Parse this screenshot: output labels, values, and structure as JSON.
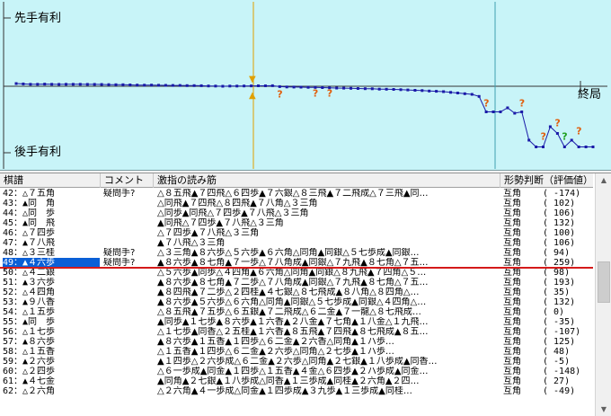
{
  "graph": {
    "sente_label": "先手有利",
    "gote_label": "後手有利",
    "end_label": "終局",
    "cursor_marker_top": "▼",
    "cursor_marker_bottom": "▲",
    "question_mark": "?",
    "colors": {
      "background": "#c8f4f8",
      "line": "#1a1aa8",
      "cursor": "#e0a000",
      "bad_move": "#e06010",
      "good_move": "#20a020"
    },
    "eval_series": [
      40,
      35,
      30,
      30,
      32,
      30,
      28,
      30,
      30,
      30,
      28,
      28,
      26,
      24,
      22,
      22,
      20,
      18,
      16,
      18,
      15,
      14,
      12,
      12,
      10,
      10,
      8,
      4,
      2,
      0,
      2,
      3,
      4,
      5,
      6,
      7,
      8,
      -5,
      -10,
      -12,
      -14,
      -16,
      -18,
      -20,
      -22,
      -26,
      -28,
      -30,
      -34,
      -36,
      -38,
      -42,
      -44,
      -46,
      -50,
      -55,
      -60,
      -64,
      -70,
      -75,
      -80,
      -90,
      -100,
      -110,
      -120,
      -150,
      -380,
      -380,
      -380,
      -320,
      -400,
      -380,
      -800,
      -900,
      -900,
      -600,
      -700,
      -900,
      -800,
      -900,
      -900,
      -900
    ]
  },
  "table": {
    "headers": [
      "棋譜",
      "コメント",
      "激指の読み筋",
      "形勢判断（評価値）"
    ],
    "rows": [
      {
        "move": "42：△７五角",
        "comment": "疑問手?",
        "line": "△８五飛▲７四飛△６四歩▲７六銀△８三飛▲７二飛成△７三飛▲同…",
        "judge": "互角",
        "eval": "(  -174)"
      },
      {
        "move": "43：▲同　角",
        "comment": "",
        "line": "△同飛▲７四飛△８四飛▲７八角△３三角",
        "judge": "互角",
        "eval": "(   102)"
      },
      {
        "move": "44：△同　歩",
        "comment": "",
        "line": "△同歩▲同飛△７四歩▲７八飛△３三角",
        "judge": "互角",
        "eval": "(   106)"
      },
      {
        "move": "45：▲同　飛",
        "comment": "",
        "line": "▲同飛△７四歩▲７八飛△３三角",
        "judge": "互角",
        "eval": "(   132)"
      },
      {
        "move": "46：△７四歩",
        "comment": "",
        "line": "△７四歩▲７八飛△３三角",
        "judge": "互角",
        "eval": "(   100)"
      },
      {
        "move": "47：▲７八飛",
        "comment": "",
        "line": "▲７八飛△３三角",
        "judge": "互角",
        "eval": "(   106)"
      },
      {
        "move": "48：△３三桂",
        "comment": "疑問手?",
        "line": "△３三角▲８六歩△５六歩▲６六角△同角▲同銀△５七歩成▲同銀…",
        "judge": "互角",
        "eval": "(    94)"
      },
      {
        "move": "49：▲４六歩",
        "comment": "疑問手?",
        "line": "▲８六歩▲８七角▲７一歩△７八角成▲同銀△７九飛▲８七角△７五…",
        "judge": "互角",
        "eval": "(   259)"
      },
      {
        "move": "50：△４二銀",
        "comment": "",
        "line": "△５六歩▲同歩△４四角▲６六角△同角▲同銀△８九飛▲７四角△５…",
        "judge": "互角",
        "eval": "(    98)"
      },
      {
        "move": "51：▲３六歩",
        "comment": "",
        "line": "▲８六歩▲８七角▲７二歩△７八角成▲同銀△７九飛▲８七角△７五…",
        "judge": "互角",
        "eval": "(   193)"
      },
      {
        "move": "52：△４四角",
        "comment": "",
        "line": "▲８四飛▲７二歩△２四桂▲４七銀△８七飛成▲８八角△８四角△…",
        "judge": "互角",
        "eval": "(    35)"
      },
      {
        "move": "53：▲９八香",
        "comment": "",
        "line": "▲８六歩▲５六歩△６六角△同角▲同銀△５七歩成▲同銀△４四角△…",
        "judge": "互角",
        "eval": "(   132)"
      },
      {
        "move": "54：△１五歩",
        "comment": "",
        "line": "△８五飛▲７五歩△６五銀▲７二飛成△６二金▲７一龍△８七飛成…",
        "judge": "互角",
        "eval": "(     0)"
      },
      {
        "move": "55：▲同　歩",
        "comment": "",
        "line": "▲同歩▲１七歩▲８六歩▲１六香▲２八金▲７七角▲１八金△１九飛…",
        "judge": "互角",
        "eval": "(   -35)"
      },
      {
        "move": "56：△１七歩",
        "comment": "",
        "line": "△１七歩▲同香△２五桂▲１六香▲８五飛▲７四飛▲８七飛成▲８五…",
        "judge": "互角",
        "eval": "(  -107)"
      },
      {
        "move": "57：▲８六歩",
        "comment": "",
        "line": "▲８六歩▲１五香▲１四歩△６二金▲２六香△同角▲１ハ歩…",
        "judge": "互角",
        "eval": "(   125)"
      },
      {
        "move": "58：△１五香",
        "comment": "",
        "line": "△１五香▲１四歩△６二金▲２六歩△同角△２七歩▲１ハ歩…",
        "judge": "互角",
        "eval": "(    48)"
      },
      {
        "move": "59：▲２六歩",
        "comment": "",
        "line": "▲１四歩△２六歩成△６二金▲２六歩△同角▲２七銀▲１八歩成▲同香…",
        "judge": "互角",
        "eval": "(    -5)"
      },
      {
        "move": "60：△２四歩",
        "comment": "",
        "line": "△６一歩成▲同金▲１四歩△１五香▲４金△６四歩▲２ハ歩成▲同金…",
        "judge": "互角",
        "eval": "(  -148)"
      },
      {
        "move": "61：▲４七金",
        "comment": "",
        "line": "▲同角▲２七銀▲１八歩成△同香▲１三歩成▲同桂▲２六角▲２四…",
        "judge": "互角",
        "eval": "(    27)"
      },
      {
        "move": "62：△２六角",
        "comment": "",
        "line": "△２六角▲４一歩成△同金▲１四歩成▲３九歩▲１三歩成▲同桂…",
        "judge": "互角",
        "eval": "(   -49)"
      }
    ],
    "selected_index": 7
  }
}
